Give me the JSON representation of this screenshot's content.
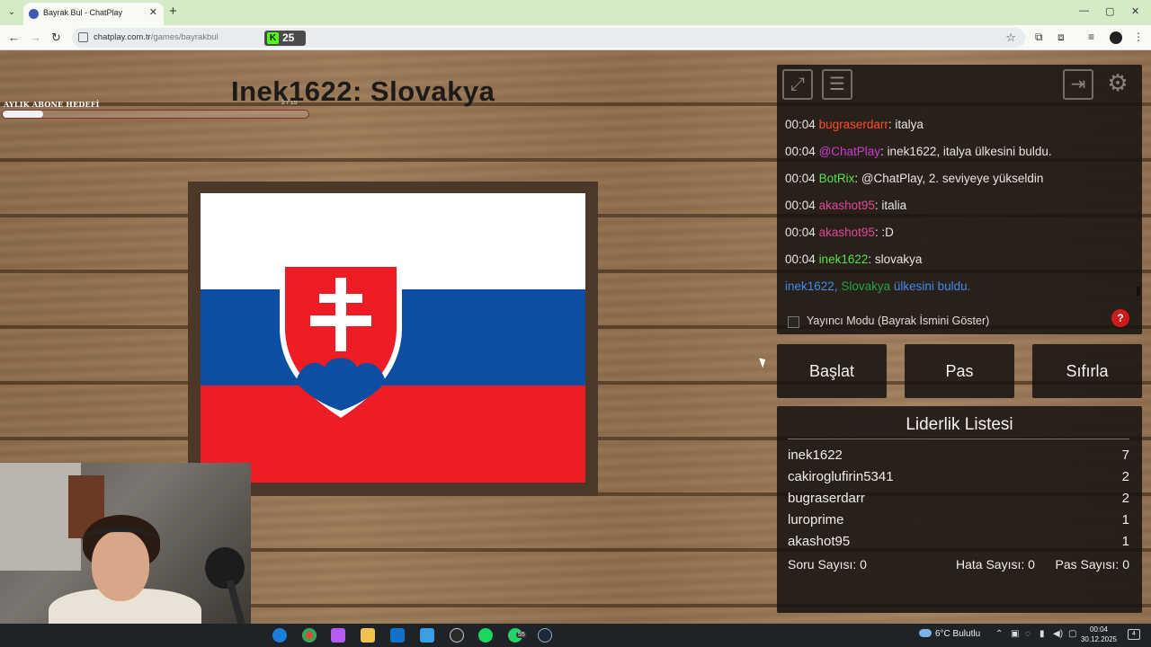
{
  "browser": {
    "tab_title": "Bayrak Bul - ChatPlay",
    "tab_close": "✕",
    "new_tab": "+",
    "url_domain": "chatplay.com.tr",
    "url_path": "/games/bayrakbul",
    "kick_badge_count": "25",
    "window_controls": [
      "—",
      "▢",
      "✕"
    ]
  },
  "game": {
    "subscription_goal_label": "AYLIK ABONE HEDEFİ",
    "subscription_goal_count": "2 / 15",
    "subscription_progress": 0.133,
    "round_title": "Inek1622: Slovakya",
    "flag_colors": {
      "white": "#ffffff",
      "blue": "#0b4ea2",
      "red": "#ee1c25"
    }
  },
  "chat": {
    "messages": [
      {
        "time": "00:04",
        "user": "bugraserdarr",
        "user_color": "#ff4b2b",
        "sep": ": ",
        "text": "italya",
        "text_color": "#e6e6e6"
      },
      {
        "time": "00:04",
        "user": "@ChatPlay",
        "user_color": "#c93ad3",
        "sep": ": ",
        "text": "inek1622, italya ülkesini buldu.",
        "text_color": "#e6e6e6"
      },
      {
        "time": "00:04",
        "user": "BotRix",
        "user_color": "#55e34b",
        "sep": ": ",
        "text": "@ChatPlay, 2. seviyeye yükseldin",
        "text_color": "#e6e6e6"
      },
      {
        "time": "00:04",
        "user": "akashot95",
        "user_color": "#e0479a",
        "sep": ": ",
        "text": "italia",
        "text_color": "#e6e6e6"
      },
      {
        "time": "00:04",
        "user": "akashot95",
        "user_color": "#e0479a",
        "sep": ": ",
        "text": ":D",
        "text_color": "#e6e6e6"
      },
      {
        "time": "00:04",
        "user": "inek1622",
        "user_color": "#55e34b",
        "sep": ": ",
        "text": "slovakya",
        "text_color": "#e6e6e6"
      }
    ],
    "system_message": {
      "user": "inek1622,",
      "country": "Slovakya",
      "text": "ülkesini buldu.",
      "user_color": "#3b8cf0",
      "country_color": "#22a34a",
      "text_color": "#3b8cf0"
    },
    "streamer_mode_label": "Yayıncı Modu (Bayrak İsmini Göster)",
    "help_label": "?"
  },
  "controls": {
    "start": "Başlat",
    "skip": "Pas",
    "reset": "Sıfırla"
  },
  "leaderboard": {
    "title": "Liderlik Listesi",
    "entries": [
      {
        "name": "inek1622",
        "score": "7"
      },
      {
        "name": "cakiroglufirin5341",
        "score": "2"
      },
      {
        "name": "bugraserdarr",
        "score": "2"
      },
      {
        "name": "luroprime",
        "score": "1"
      },
      {
        "name": "akashot95",
        "score": "1"
      }
    ],
    "question_count": "Soru Sayısı: 0",
    "error_count": "Hata Sayısı: 0",
    "skip_count": "Pas Sayısı: 0"
  },
  "taskbar": {
    "whatsapp_badge": "55",
    "weather": "6°C  Bulutlu",
    "time": "00:04",
    "date": "30.12.2025",
    "notification_count": "4"
  },
  "icons": [
    "fullscreen-icon",
    "notes-icon",
    "logout-icon",
    "gear-icon",
    "back-icon",
    "forward-icon",
    "reload-icon",
    "star-icon"
  ]
}
